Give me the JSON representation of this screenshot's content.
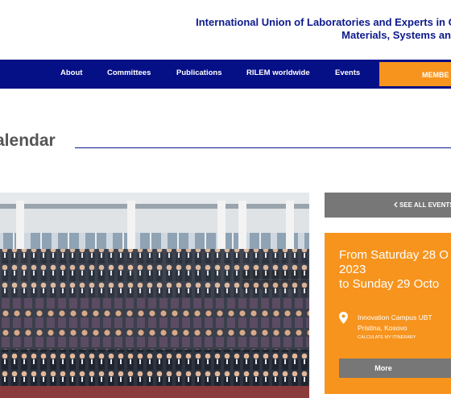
{
  "header": {
    "tagline_line1": "International Union of Laboratories and Experts in C",
    "tagline_line2": "Materials, Systems an"
  },
  "nav": {
    "items": [
      {
        "label": "About"
      },
      {
        "label": "Committees"
      },
      {
        "label": "Publications"
      },
      {
        "label": "RILEM worldwide"
      },
      {
        "label": "Events"
      }
    ],
    "member_label": "MEMBE"
  },
  "page": {
    "title": "alendar"
  },
  "event": {
    "see_all_label": "SEE ALL EVENTS",
    "date_line1": "From Saturday 28 O",
    "date_line2": "2023",
    "date_line3": "to Sunday 29 Octo",
    "venue": "Innovation Campus UBT",
    "city": "Pristina, Kosovo",
    "itinerary_label": "CALCULATE MY ITINERARY",
    "more_label": "More"
  },
  "colors": {
    "brand_blue": "#050f86",
    "accent_orange": "#f7941d",
    "grey_button": "#777777"
  },
  "icons": [
    "chevron-left-icon",
    "location-pin-icon"
  ]
}
